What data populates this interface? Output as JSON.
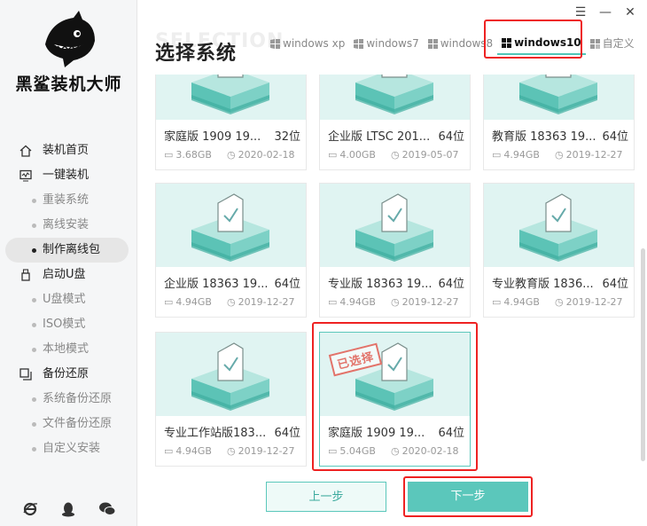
{
  "app": {
    "name": "黑鲨装机大师"
  },
  "sidebar": {
    "items": [
      {
        "label": "装机首页",
        "icon": "home-icon",
        "kind": "main"
      },
      {
        "label": "一键装机",
        "icon": "monitor-icon",
        "kind": "main"
      },
      {
        "label": "重装系统",
        "kind": "sub"
      },
      {
        "label": "离线安装",
        "kind": "sub"
      },
      {
        "label": "制作离线包",
        "kind": "sub-active"
      },
      {
        "label": "启动U盘",
        "icon": "usb-icon",
        "kind": "main"
      },
      {
        "label": "U盘模式",
        "kind": "sub"
      },
      {
        "label": "ISO模式",
        "kind": "sub"
      },
      {
        "label": "本地模式",
        "kind": "sub"
      },
      {
        "label": "备份还原",
        "icon": "backup-icon",
        "kind": "main"
      },
      {
        "label": "系统备份还原",
        "kind": "sub"
      },
      {
        "label": "文件备份还原",
        "kind": "sub"
      },
      {
        "label": "自定义安装",
        "kind": "sub"
      }
    ]
  },
  "header": {
    "title": "选择系统",
    "title_bg": "SELECTION",
    "tabs": [
      {
        "label": "windows xp",
        "selected": false
      },
      {
        "label": "windows7",
        "selected": false
      },
      {
        "label": "windows8",
        "selected": false
      },
      {
        "label": "windows10",
        "selected": true
      },
      {
        "label": "自定义",
        "selected": false
      }
    ]
  },
  "cards": [
    {
      "name": "家庭版 1909 19...",
      "bits": "32位",
      "size": "3.68GB",
      "date": "2020-02-18",
      "selected": false
    },
    {
      "name": "企业版 LTSC 201...",
      "bits": "64位",
      "size": "4.00GB",
      "date": "2019-05-07",
      "selected": false
    },
    {
      "name": "教育版 18363 19...",
      "bits": "64位",
      "size": "4.94GB",
      "date": "2019-12-27",
      "selected": false
    },
    {
      "name": "企业版 18363 19...",
      "bits": "64位",
      "size": "4.94GB",
      "date": "2019-12-27",
      "selected": false
    },
    {
      "name": "专业版 18363 19...",
      "bits": "64位",
      "size": "4.94GB",
      "date": "2019-12-27",
      "selected": false
    },
    {
      "name": "专业教育版 1836...",
      "bits": "64位",
      "size": "4.94GB",
      "date": "2019-12-27",
      "selected": false
    },
    {
      "name": "专业工作站版183...",
      "bits": "64位",
      "size": "4.94GB",
      "date": "2019-12-27",
      "selected": false
    },
    {
      "name": "家庭版 1909 19...",
      "bits": "64位",
      "size": "5.04GB",
      "date": "2020-02-18",
      "selected": true,
      "stamp": "已选择"
    }
  ],
  "buttons": {
    "prev": "上一步",
    "next": "下一步"
  },
  "colors": {
    "accent": "#5bc7bb",
    "highlight": "#e22222"
  }
}
